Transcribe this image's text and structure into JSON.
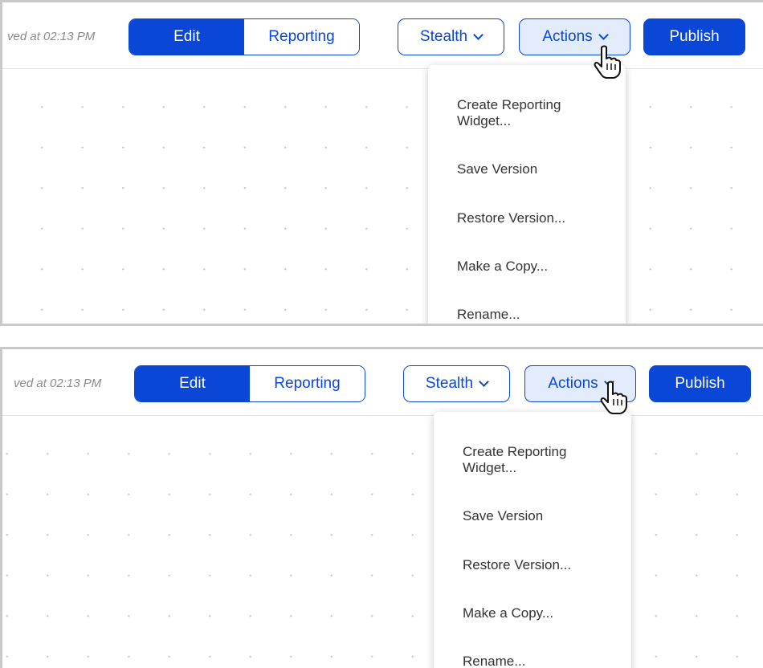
{
  "toolbar": {
    "saved_text": "ved at 02:13 PM",
    "mode_toggle": {
      "edit_label": "Edit",
      "reporting_label": "Reporting"
    },
    "stealth_label": "Stealth",
    "actions_label": "Actions",
    "publish_label": "Publish"
  },
  "actions_menu": {
    "items": [
      {
        "label": "Create Reporting\nWidget..."
      },
      {
        "label": "Save Version"
      },
      {
        "label": "Restore Version..."
      },
      {
        "label": "Make a Copy..."
      },
      {
        "label": "Rename..."
      }
    ]
  },
  "colors": {
    "accent": "#0a47d6",
    "pressed": "#e2ecfd",
    "saved_text": "#8a8a8a"
  },
  "icons": [
    "chevron-down-icon",
    "hand-pointer-icon"
  ]
}
